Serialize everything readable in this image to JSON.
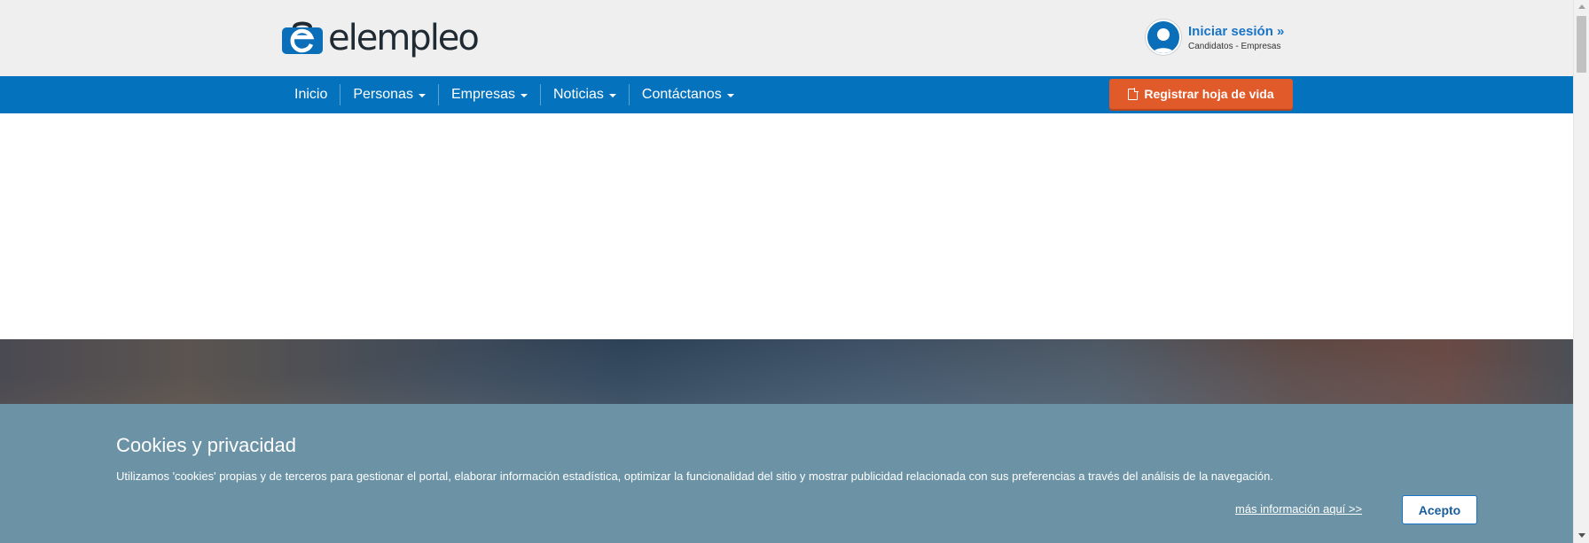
{
  "header": {
    "logo_text": "elempleo",
    "login_title": "Iniciar sesión",
    "login_chevron": "»",
    "login_subtitle": "Candidatos - Empresas"
  },
  "nav": {
    "items": [
      {
        "label": "Inicio",
        "has_dropdown": false
      },
      {
        "label": "Personas",
        "has_dropdown": true
      },
      {
        "label": "Empresas",
        "has_dropdown": true
      },
      {
        "label": "Noticias",
        "has_dropdown": true
      },
      {
        "label": "Contáctanos",
        "has_dropdown": true
      }
    ],
    "register_label": "Registrar hoja de vida",
    "register_icon": "document-icon"
  },
  "cookies": {
    "title": "Cookies y privacidad",
    "text": "Utilizamos 'cookies' propias y de terceros para gestionar el portal, elaborar información estadística, optimizar la funcionalidad del sitio y mostrar publicidad relacionada con sus preferencias a través del análisis de la navegación.",
    "more_link": "más información aquí >>",
    "accept_label": "Acepto"
  },
  "colors": {
    "brand_blue": "#0472bc",
    "accent_orange": "#e15a2a",
    "cookie_bg": "#6b93a5",
    "header_bg": "#efefef"
  }
}
